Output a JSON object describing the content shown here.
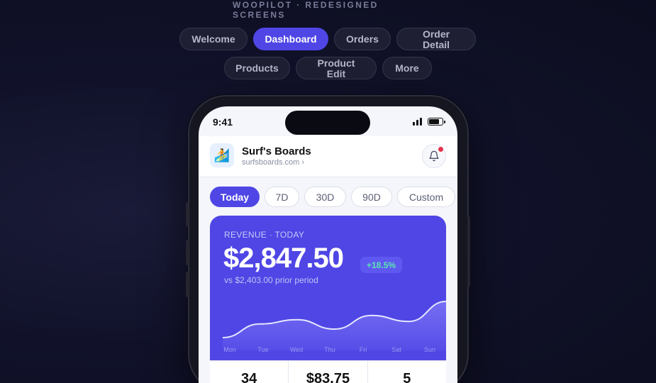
{
  "header": {
    "title": "WOOPILOT · REDESIGNED SCREENS"
  },
  "nav": {
    "row1": [
      "Welcome",
      "Dashboard",
      "Orders",
      "Order Detail"
    ],
    "row2": [
      "Products",
      "Product Edit",
      "More"
    ],
    "active": "Dashboard"
  },
  "phone": {
    "time": "9:41",
    "store": {
      "name": "Surf's Boards",
      "url": "surfsboards.com ›",
      "logo": "🏄"
    },
    "ranges": [
      "Today",
      "7D",
      "30D",
      "90D",
      "Custom"
    ],
    "active_range": "Today",
    "revenue": {
      "label": "REVENUE · TODAY",
      "value": "$2,847.50",
      "delta": "+18.5%",
      "prior": "vs $2,403.00 prior period"
    },
    "kpis": [
      "34",
      "$83.75",
      "5"
    ]
  },
  "chart_data": {
    "type": "area",
    "x": [
      "Mon",
      "Tue",
      "Wed",
      "Thu",
      "Fri",
      "Sat",
      "Sun"
    ],
    "series": [
      {
        "values": [
          0.1,
          0.42,
          0.52,
          0.3,
          0.62,
          0.48,
          0.95
        ]
      }
    ],
    "colors": {
      "line": "#e6e7ff",
      "fill": "#7b73f5",
      "label": "#9a96f0"
    }
  }
}
